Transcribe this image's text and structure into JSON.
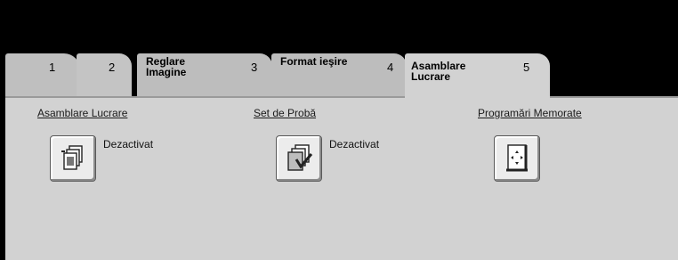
{
  "tabs": [
    {
      "number": "1",
      "label": ""
    },
    {
      "number": "2",
      "label": ""
    },
    {
      "number": "3",
      "label": "Reglare Imagine"
    },
    {
      "number": "4",
      "label": "Format ieşire"
    },
    {
      "number": "5",
      "label": "Asamblare Lucrare",
      "selected": true
    }
  ],
  "panel": {
    "sections": [
      {
        "heading": "Asamblare Lucrare",
        "icon": "job-build-icon",
        "status": "Dezactivat"
      },
      {
        "heading": "Set de Probă",
        "icon": "sample-set-icon",
        "status": "Dezactivat"
      },
      {
        "heading": "Programări Memorate",
        "icon": "stored-programming-icon",
        "status": ""
      }
    ]
  },
  "colors": {
    "background": "#000000",
    "panel": "#d2d2d2",
    "tab_inactive": "#bdbdbd",
    "tab_active": "#d2d2d2"
  }
}
